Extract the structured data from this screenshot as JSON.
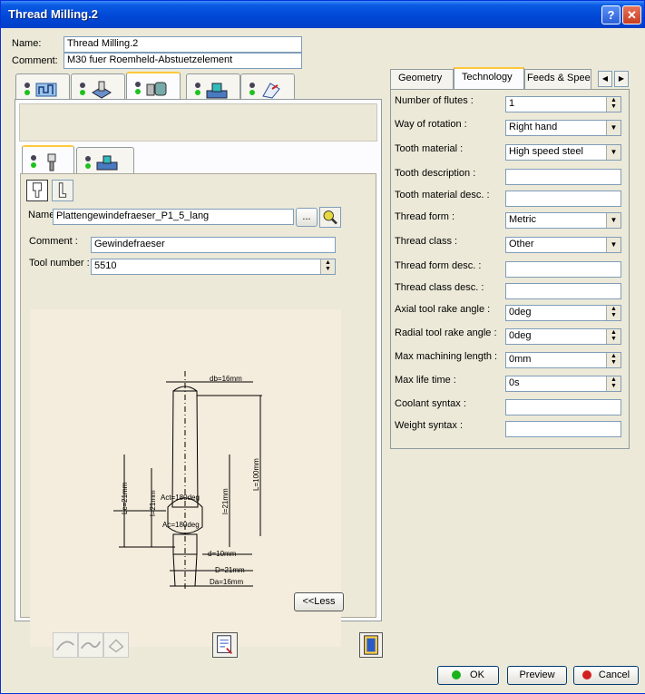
{
  "window": {
    "title": "Thread Milling.2",
    "help_glyph": "?",
    "close_glyph": "✕"
  },
  "header": {
    "name_label": "Name:",
    "name_value": "Thread Milling.2",
    "comment_label": "Comment:",
    "comment_value": "M30 fuer Roemheld-Abstuetzelement"
  },
  "tool": {
    "name_label": "Name",
    "name_value": "Plattengewindefraeser_P1_5_lang",
    "browse_label": "...",
    "comment_label": "Comment :",
    "comment_value": "Gewindefraeser",
    "number_label": "Tool number :",
    "number_value": "5510",
    "less_label": "<<Less"
  },
  "drawing_labels": {
    "db": "db=16mm",
    "L": "L=100mm",
    "lc": "Lc=21mm",
    "l": "l=21mm",
    "lm": "l=21mm",
    "act1": "Act=180deg",
    "act2": "Ac=180deg",
    "d": "d=10mm",
    "D": "D=21mm",
    "Da": "Da=16mm"
  },
  "right_tabs": {
    "geometry": "Geometry",
    "technology": "Technology",
    "feeds": "Feeds & Speed"
  },
  "technology": {
    "flutes_label": "Number of flutes :",
    "flutes_value": "1",
    "rotation_label": "Way of rotation :",
    "rotation_value": "Right hand",
    "tooth_material_label": "Tooth material :",
    "tooth_material_value": "High speed steel",
    "tooth_desc_label": "Tooth description :",
    "tooth_desc_value": "",
    "tooth_mat_desc_label": "Tooth material desc. :",
    "tooth_mat_desc_value": "",
    "thread_form_label": "Thread form :",
    "thread_form_value": "Metric",
    "thread_class_label": "Thread class :",
    "thread_class_value": "Other",
    "thread_form_desc_label": "Thread form desc. :",
    "thread_form_desc_value": "",
    "thread_class_desc_label": "Thread class desc. :",
    "thread_class_desc_value": "",
    "axial_rake_label": "Axial tool rake angle  :",
    "axial_rake_value": "0deg",
    "radial_rake_label": "Radial tool rake angle  :",
    "radial_rake_value": "0deg",
    "max_len_label": "Max machining length :",
    "max_len_value": "0mm",
    "max_life_label": "Max life time :",
    "max_life_value": "0s",
    "coolant_label": "Coolant syntax :",
    "coolant_value": "",
    "weight_label": "Weight syntax :",
    "weight_value": ""
  },
  "footer": {
    "ok": "OK",
    "preview": "Preview",
    "cancel": "Cancel"
  },
  "colors": {
    "accent": "#0a5ce3",
    "dialog_bg": "#ece9d8",
    "tab_highlight": "#ffc83c"
  }
}
